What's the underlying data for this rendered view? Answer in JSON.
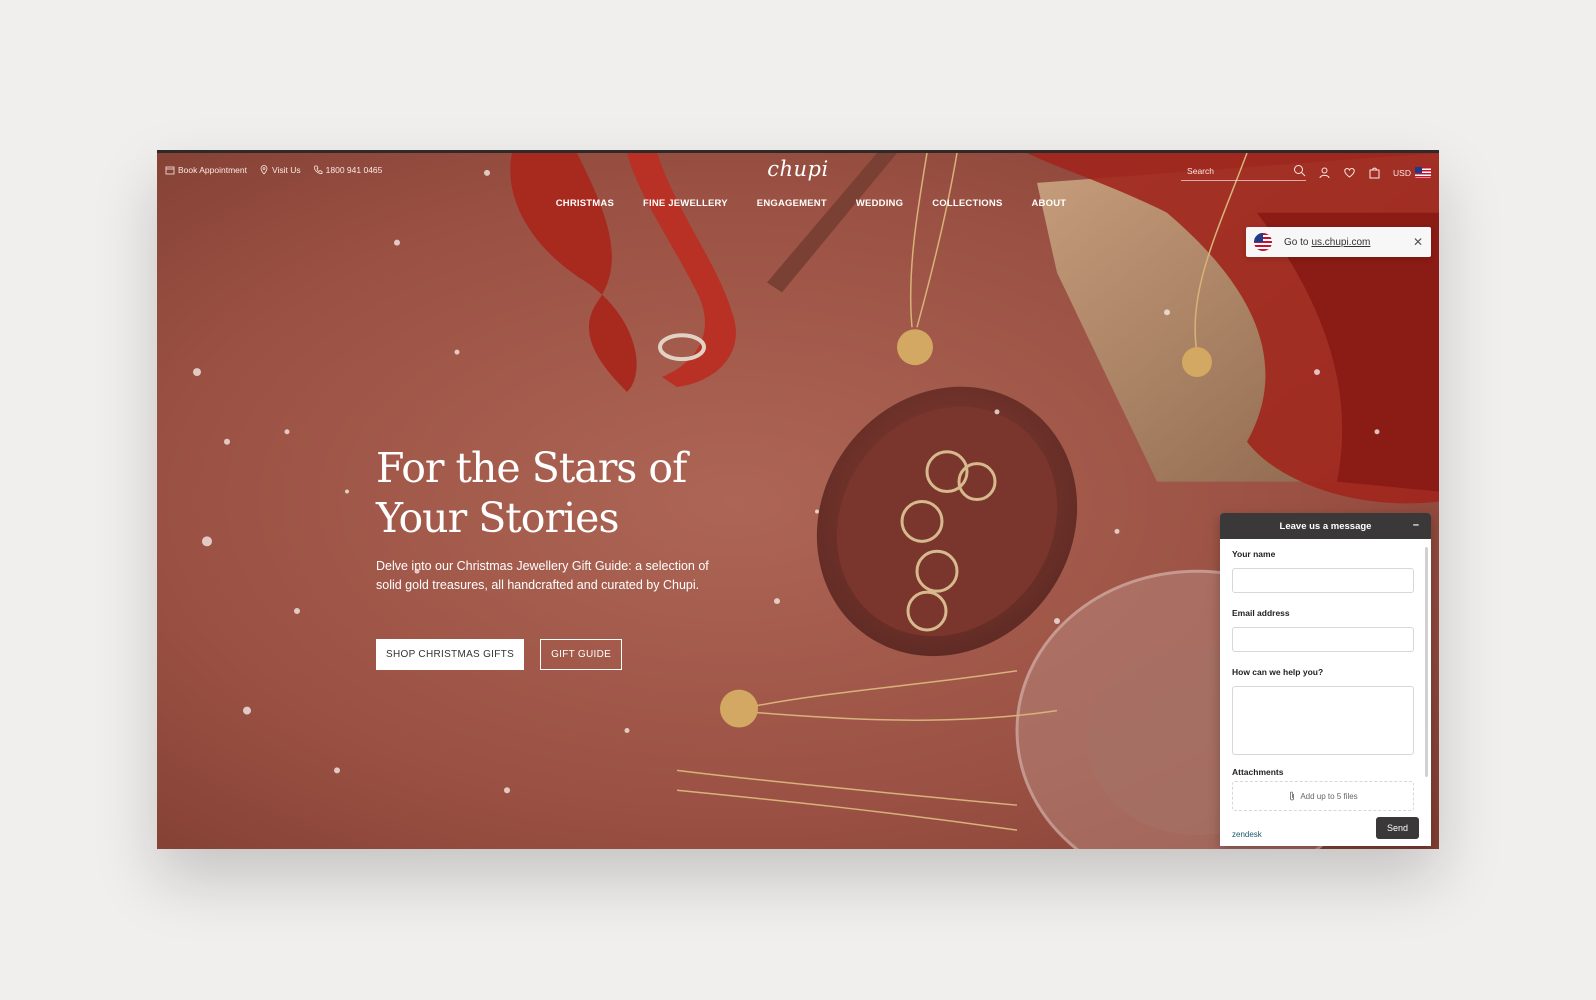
{
  "topbar": {
    "book_appointment": "Book Appointment",
    "visit_us": "Visit Us",
    "phone": "1800 941 0465",
    "logo": "chupi",
    "search_placeholder": "Search",
    "currency": "USD"
  },
  "nav": [
    "CHRISTMAS",
    "FINE JEWELLERY",
    "ENGAGEMENT",
    "WEDDING",
    "COLLECTIONS",
    "ABOUT"
  ],
  "region_notice": {
    "prefix": "Go to",
    "link": "us.chupi.com",
    "close": "✕"
  },
  "hero": {
    "title": "For the Stars of Your Stories",
    "text": "Delve into our Christmas Jewellery Gift Guide: a selection of solid gold treasures, all handcrafted and curated by Chupi.",
    "primary_cta": "SHOP CHRISTMAS GIFTS",
    "secondary_cta": "GIFT GUIDE"
  },
  "chat": {
    "title": "Leave us a message",
    "minimize": "–",
    "name_label": "Your name",
    "email_label": "Email address",
    "help_label": "How can we help you?",
    "attachments_label": "Attachments",
    "attach_text": "Add up to 5 files",
    "brand": "zendesk",
    "send": "Send"
  },
  "colors": {
    "page_bg": "#f1efee",
    "hero_bg": "#9c5346",
    "chat_header": "#3a3838",
    "ribbon": "#a82a1f"
  }
}
